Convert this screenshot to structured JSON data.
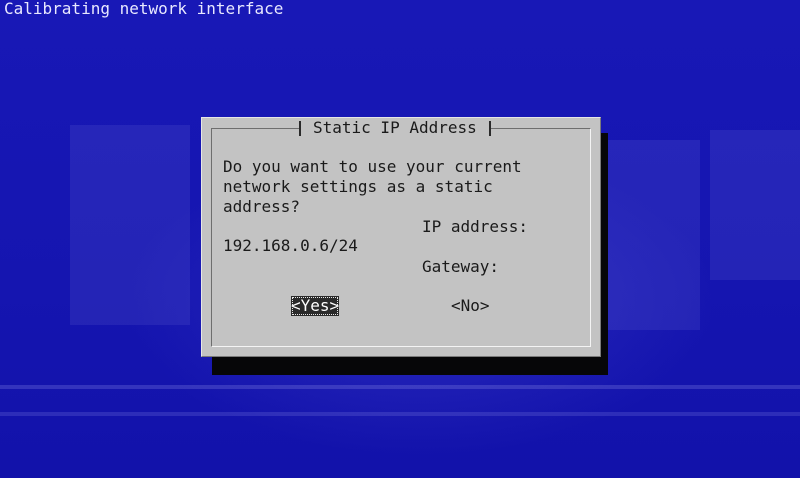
{
  "screen": {
    "title": "Calibrating network interface"
  },
  "dialog": {
    "title": "Static IP Address",
    "prompt_lines": [
      "Do you want to use your current",
      "network settings as a static",
      "address?"
    ],
    "ip_label": "IP address:",
    "ip_value": "192.168.0.6/24",
    "gateway_label": "Gateway:",
    "buttons": {
      "yes": "<Yes>",
      "no": "<No>"
    },
    "selected_button": "yes"
  },
  "colors": {
    "background": "#1414b4",
    "dialog": "#c3c3c3",
    "selected_button_bg": "#2a2a2a"
  }
}
